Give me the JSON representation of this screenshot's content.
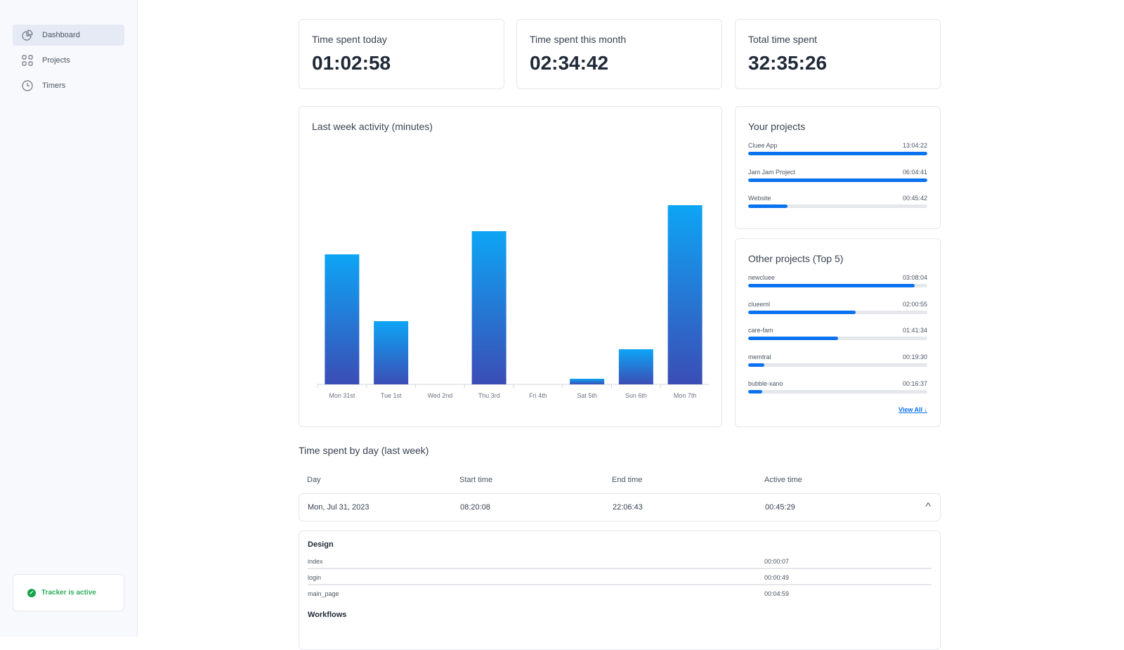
{
  "sidebar": {
    "items": [
      {
        "label": "Dashboard",
        "icon": "pie-chart-icon"
      },
      {
        "label": "Projects",
        "icon": "grid-icon"
      },
      {
        "label": "Timers",
        "icon": "clock-icon"
      }
    ],
    "tracker": "Tracker is active"
  },
  "stats": [
    {
      "label": "Time spent today",
      "value": "01:02:58"
    },
    {
      "label": "Time spent this month",
      "value": "02:34:42"
    },
    {
      "label": "Total time spent",
      "value": "32:35:26"
    }
  ],
  "chart_data": {
    "type": "bar",
    "title": "Last week activity (minutes)",
    "categories": [
      "Mon 31st",
      "Tue 1st",
      "Wed 2nd",
      "Thu 3rd",
      "Fri 4th",
      "Sat 5th",
      "Sun 6th",
      "Mon 7th"
    ],
    "values": [
      185,
      90,
      0,
      218,
      0,
      8,
      50,
      255
    ],
    "ylim": [
      0,
      346
    ],
    "grid": false,
    "colors": {
      "top": "#0ea5f5",
      "bottom": "#3b4db5"
    }
  },
  "your_projects": {
    "title": "Your projects",
    "items": [
      {
        "name": "Cluee App",
        "time": "13:04:22",
        "fraction": 1.0
      },
      {
        "name": "Jam Jam Project",
        "time": "06:04:41",
        "fraction": 1.0
      },
      {
        "name": "Website",
        "time": "00:45:42",
        "fraction": 0.22
      }
    ]
  },
  "other_projects": {
    "title": "Other projects (Top 5)",
    "items": [
      {
        "name": "newcluee",
        "time": "03:08:04",
        "fraction": 0.93
      },
      {
        "name": "clueeml",
        "time": "02:00:55",
        "fraction": 0.6
      },
      {
        "name": "care-fam",
        "time": "01:41:34",
        "fraction": 0.5
      },
      {
        "name": "memtral",
        "time": "00:19:30",
        "fraction": 0.09
      },
      {
        "name": "bubble-xano",
        "time": "00:16:37",
        "fraction": 0.08
      }
    ],
    "view_all": "View All ↓"
  },
  "table": {
    "title": "Time spent by day (last week)",
    "headers": [
      "Day",
      "Start time",
      "End time",
      "Active time"
    ],
    "row": [
      "Mon, Jul 31, 2023",
      "08:20:08",
      "22:06:43",
      "00:45:29"
    ],
    "details": {
      "design_title": "Design",
      "design": [
        {
          "name": "index",
          "time": "00:00:07"
        },
        {
          "name": "login",
          "time": "00:00:49"
        },
        {
          "name": "main_page",
          "time": "00:04:59"
        }
      ],
      "workflows_title": "Workflows"
    }
  }
}
